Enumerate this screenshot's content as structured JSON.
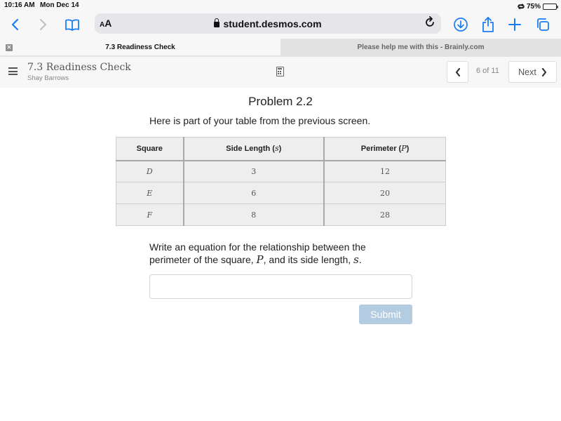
{
  "status_bar": {
    "time": "10:16 AM",
    "date": "Mon Dec 14",
    "battery_percent_label": "75%",
    "battery_level": 0.75
  },
  "browser": {
    "text_size_button": {
      "small": "A",
      "large": "A"
    },
    "url": "student.desmos.com",
    "icons": {
      "back": "chevron-left-icon",
      "forward": "chevron-right-icon",
      "bookmarks": "book-icon",
      "reload": "reload-icon",
      "downloads": "download-icon",
      "share": "share-icon",
      "new_tab": "plus-icon",
      "tabs": "tabs-icon"
    },
    "accent_color": "#1a7cf4"
  },
  "tabs": [
    {
      "label": "7.3 Readiness Check",
      "active": true
    },
    {
      "label": "Please help me with this - Brainly.com",
      "active": false
    }
  ],
  "header": {
    "activity_title": "7.3 Readiness Check",
    "student_name": "Shay Barrows",
    "page_indicator": "6 of 11",
    "next_label": "Next",
    "prev_icon": "chevron-left-icon",
    "next_icon": "chevron-right-icon"
  },
  "content": {
    "problem_title": "Problem 2.2",
    "intro": "Here is part of your table from the previous screen.",
    "table": {
      "headers": [
        {
          "text": "Square",
          "var": ""
        },
        {
          "text": "Side Length (",
          "var": "s",
          "suffix": ")"
        },
        {
          "text": "Perimeter (",
          "var": "P",
          "suffix": ")"
        }
      ],
      "rows": [
        [
          "D",
          "3",
          "12"
        ],
        [
          "E",
          "6",
          "20"
        ],
        [
          "F",
          "8",
          "28"
        ]
      ]
    },
    "question": {
      "line1": "Write an equation for the relationship between the",
      "line2_a": "perimeter of the square, ",
      "var_p": "P",
      "line2_b": ", and its side length, ",
      "var_s": "s",
      "line2_c": "."
    },
    "answer_value": "",
    "submit_label": "Submit",
    "submit_color": "#b4cce2"
  }
}
